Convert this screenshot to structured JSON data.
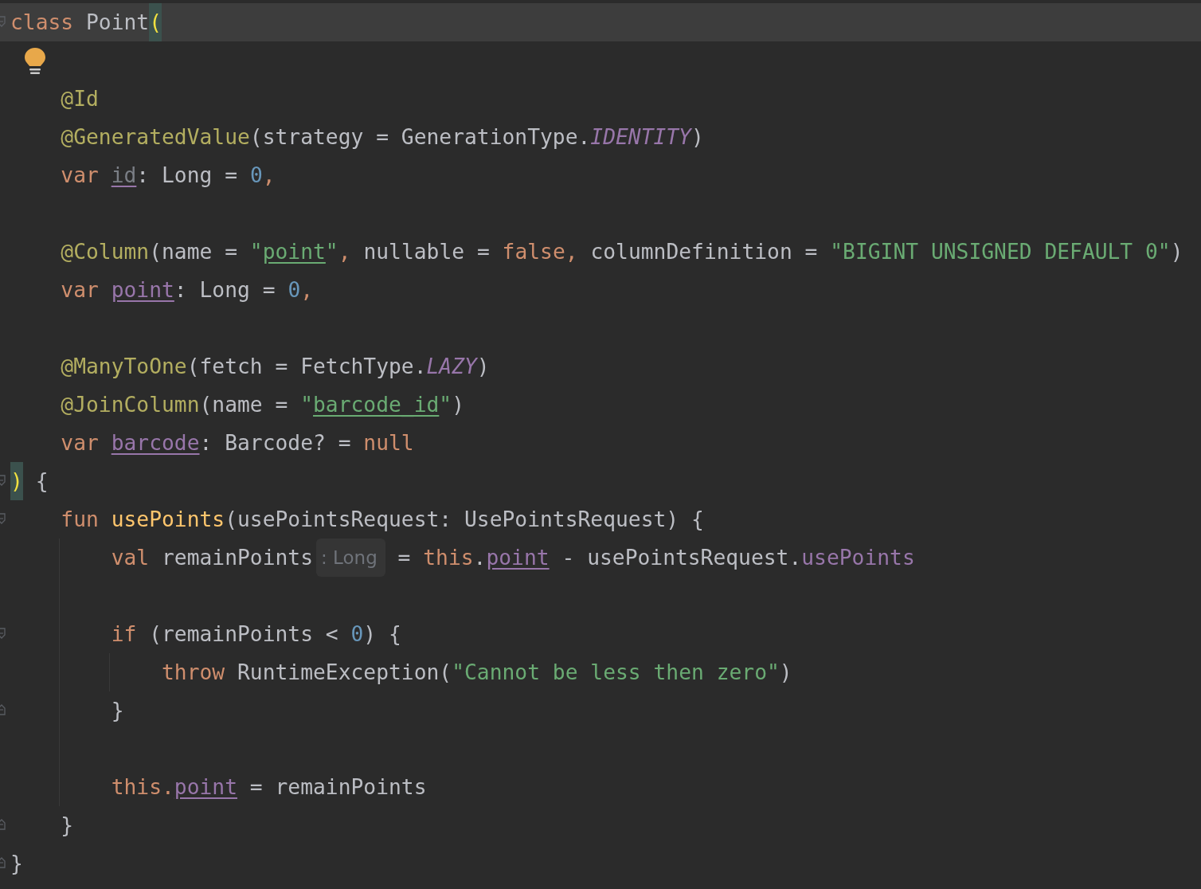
{
  "editor": {
    "lines": [
      {
        "current": true,
        "fold": {
          "kind": "start"
        },
        "tokens": [
          {
            "kind": "keyword",
            "text": "class"
          },
          {
            "kind": "plain",
            "text": " Point"
          },
          {
            "kind": "brace-match",
            "text": "("
          }
        ]
      },
      {
        "current": false,
        "bulb": true
      },
      {
        "current": false,
        "tokens": [
          {
            "kind": "annotation",
            "text": "    @Id"
          }
        ]
      },
      {
        "current": false,
        "tokens": [
          {
            "kind": "annotation",
            "text": "    @GeneratedValue"
          },
          {
            "kind": "plain",
            "text": "(strategy = GenerationType."
          },
          {
            "kind": "constant",
            "text": "IDENTITY"
          },
          {
            "kind": "plain",
            "text": ")"
          }
        ]
      },
      {
        "current": false,
        "tokens": [
          {
            "kind": "keyword",
            "text": "    var "
          },
          {
            "kind": "unused",
            "text": "id"
          },
          {
            "kind": "plain",
            "text": ": Long = "
          },
          {
            "kind": "number",
            "text": "0"
          },
          {
            "kind": "keyword",
            "text": ","
          }
        ]
      },
      {
        "current": false
      },
      {
        "current": false,
        "tokens": [
          {
            "kind": "annotation",
            "text": "    @Column"
          },
          {
            "kind": "plain",
            "text": "(name = "
          },
          {
            "kind": "string",
            "text": "\""
          },
          {
            "kind": "string-ref",
            "text": "point"
          },
          {
            "kind": "string",
            "text": "\""
          },
          {
            "kind": "keyword",
            "text": ","
          },
          {
            "kind": "plain",
            "text": " nullable = "
          },
          {
            "kind": "keyword",
            "text": "false,"
          },
          {
            "kind": "plain",
            "text": " columnDefinition = "
          },
          {
            "kind": "string",
            "text": "\"BIGINT UNSIGNED DEFAULT 0\""
          },
          {
            "kind": "plain",
            "text": ")"
          }
        ]
      },
      {
        "current": false,
        "tokens": [
          {
            "kind": "keyword",
            "text": "    var "
          },
          {
            "kind": "property",
            "text": "point"
          },
          {
            "kind": "plain",
            "text": ": Long = "
          },
          {
            "kind": "number",
            "text": "0"
          },
          {
            "kind": "keyword",
            "text": ","
          }
        ]
      },
      {
        "current": false
      },
      {
        "current": false,
        "tokens": [
          {
            "kind": "annotation",
            "text": "    @ManyToOne"
          },
          {
            "kind": "plain",
            "text": "(fetch = FetchType."
          },
          {
            "kind": "constant",
            "text": "LAZY"
          },
          {
            "kind": "plain",
            "text": ")"
          }
        ]
      },
      {
        "current": false,
        "tokens": [
          {
            "kind": "annotation",
            "text": "    @JoinColumn"
          },
          {
            "kind": "plain",
            "text": "(name = "
          },
          {
            "kind": "string",
            "text": "\""
          },
          {
            "kind": "string-ref",
            "text": "barcode_id"
          },
          {
            "kind": "string",
            "text": "\""
          },
          {
            "kind": "plain",
            "text": ")"
          }
        ]
      },
      {
        "current": false,
        "tokens": [
          {
            "kind": "keyword",
            "text": "    var "
          },
          {
            "kind": "property",
            "text": "barcode"
          },
          {
            "kind": "plain",
            "text": ": Barcode? = "
          },
          {
            "kind": "keyword",
            "text": "null"
          }
        ]
      },
      {
        "current": false,
        "fold": {
          "kind": "start"
        },
        "tokens": [
          {
            "kind": "brace-match",
            "text": ")"
          },
          {
            "kind": "plain",
            "text": " {"
          }
        ]
      },
      {
        "current": false,
        "fold": {
          "kind": "start"
        },
        "tokens": [
          {
            "kind": "keyword",
            "text": "    fun "
          },
          {
            "kind": "function",
            "text": "usePoints"
          },
          {
            "kind": "plain",
            "text": "(usePointsRequest: UsePointsRequest) {"
          }
        ]
      },
      {
        "current": false,
        "tokens": [
          {
            "kind": "keyword",
            "text": "        val "
          },
          {
            "kind": "plain",
            "text": "remainPoints"
          },
          {
            "kind": "hint",
            "text": ": Long"
          },
          {
            "kind": "plain",
            "text": " = "
          },
          {
            "kind": "keyword",
            "text": "this"
          },
          {
            "kind": "plain",
            "text": "."
          },
          {
            "kind": "property",
            "text": "point"
          },
          {
            "kind": "plain",
            "text": " - usePointsRequest."
          },
          {
            "kind": "field",
            "text": "usePoints"
          }
        ]
      },
      {
        "current": false
      },
      {
        "current": false,
        "fold": {
          "kind": "start"
        },
        "tokens": [
          {
            "kind": "keyword",
            "text": "        if"
          },
          {
            "kind": "plain",
            "text": " (remainPoints < "
          },
          {
            "kind": "number",
            "text": "0"
          },
          {
            "kind": "plain",
            "text": ") {"
          }
        ]
      },
      {
        "current": false,
        "tokens": [
          {
            "kind": "keyword",
            "text": "            throw "
          },
          {
            "kind": "plain",
            "text": "RuntimeException("
          },
          {
            "kind": "string",
            "text": "\"Cannot be less then zero\""
          },
          {
            "kind": "plain",
            "text": ")"
          }
        ]
      },
      {
        "current": false,
        "fold": {
          "kind": "end"
        },
        "tokens": [
          {
            "kind": "plain",
            "text": "        }"
          }
        ]
      },
      {
        "current": false
      },
      {
        "current": false,
        "tokens": [
          {
            "kind": "keyword",
            "text": "        this."
          },
          {
            "kind": "property",
            "text": "point"
          },
          {
            "kind": "plain",
            "text": " = remainPoints"
          }
        ]
      },
      {
        "current": false,
        "fold": {
          "kind": "end"
        },
        "tokens": [
          {
            "kind": "plain",
            "text": "    }"
          }
        ]
      },
      {
        "current": false,
        "fold": {
          "kind": "end"
        },
        "tokens": [
          {
            "kind": "plain",
            "text": "}"
          }
        ]
      }
    ]
  }
}
